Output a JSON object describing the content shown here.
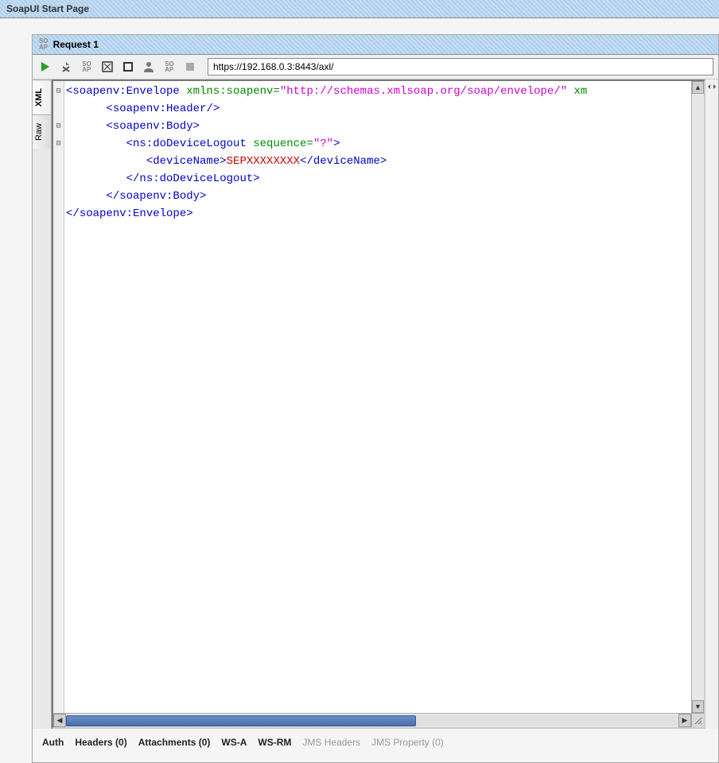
{
  "topTitle": "SoapUI Start Page",
  "requestTab": "Request 1",
  "url": "https://192.168.0.3:8443/axl/",
  "sideTabs": {
    "xml": "XML",
    "raw": "Raw"
  },
  "bottomTabs": {
    "auth": "Auth",
    "headers": "Headers (0)",
    "attachments": "Attachments (0)",
    "wsa": "WS-A",
    "wsrm": "WS-RM",
    "jmsHeaders": "JMS Headers",
    "jmsProperty": "JMS Property (0)"
  },
  "xml": {
    "l1a": "<",
    "l1b": "soapenv:Envelope",
    "l1c": " xmlns:soapenv",
    "l1d": "=",
    "l1e": "\"http://schemas.xmlsoap.org/soap/envelope/\"",
    "l1f": " xm",
    "l2a": "      <",
    "l2b": "soapenv:Header",
    "l2c": "/>",
    "l3a": "      <",
    "l3b": "soapenv:Body",
    "l3c": ">",
    "l4a": "         <",
    "l4b": "ns:doDeviceLogout",
    "l4c": " sequence",
    "l4d": "=",
    "l4e": "\"?\"",
    "l4f": ">",
    "l5a": "            <",
    "l5b": "deviceName",
    "l5c": ">",
    "l5d": "SEPXXXXXXXX",
    "l5e": "</",
    "l5f": "deviceName",
    "l5g": ">",
    "l6a": "         </",
    "l6b": "ns:doDeviceLogout",
    "l6c": ">",
    "l7a": "      </",
    "l7b": "soapenv:Body",
    "l7c": ">",
    "l8a": "</",
    "l8b": "soapenv:Envelope",
    "l8c": ">"
  }
}
